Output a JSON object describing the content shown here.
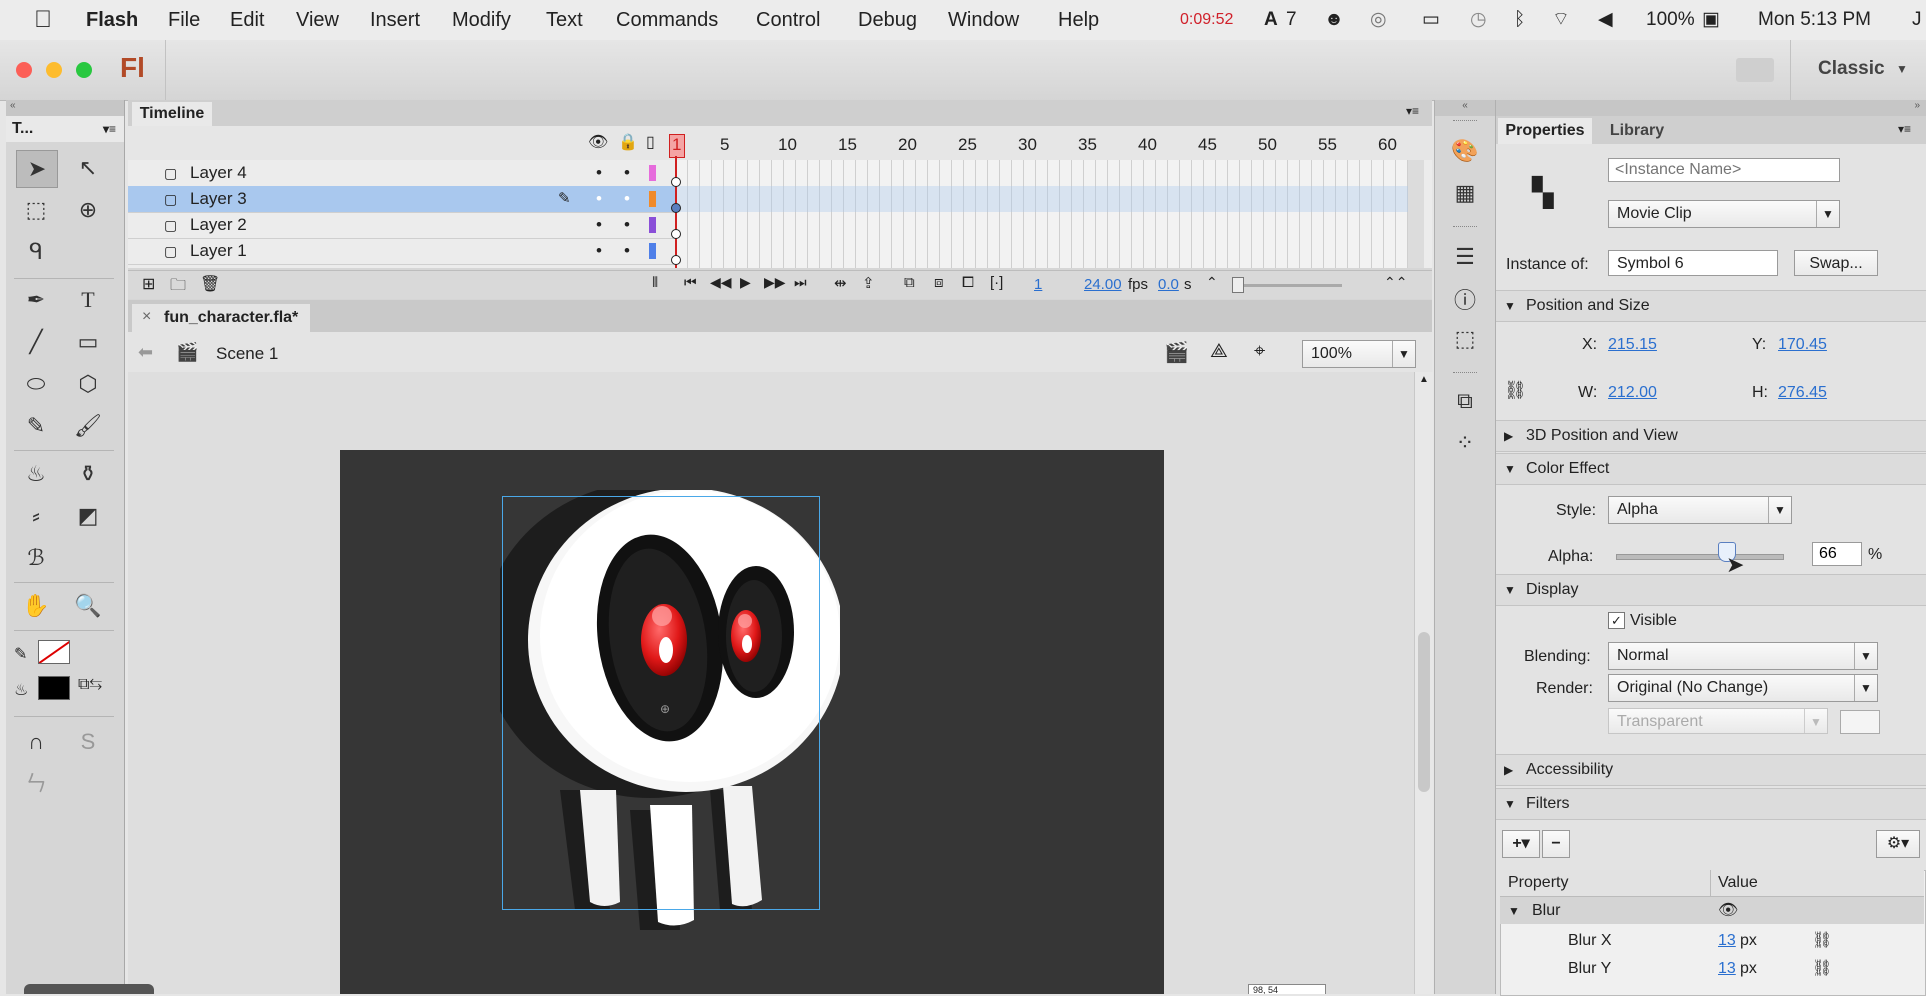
{
  "menubar": {
    "apple": "",
    "app": "Flash",
    "items": [
      "File",
      "Edit",
      "View",
      "Insert",
      "Modify",
      "Text",
      "Commands",
      "Control",
      "Debug",
      "Window",
      "Help"
    ],
    "rec_time": "0:09:52",
    "adobe_count": "7",
    "battery": "100%",
    "clock": "Mon 5:13 PM",
    "user": "J"
  },
  "appbar": {
    "logo": "Fl",
    "workspace": "Classic"
  },
  "tools": {
    "title": "T..."
  },
  "timeline": {
    "tab": "Timeline",
    "ticks": [
      "1",
      "5",
      "10",
      "15",
      "20",
      "25",
      "30",
      "35",
      "40",
      "45",
      "50",
      "55",
      "60"
    ],
    "layers": [
      {
        "name": "Layer 4",
        "color": "#e66cdc"
      },
      {
        "name": "Layer 3",
        "color": "#f08a2a"
      },
      {
        "name": "Layer 2",
        "color": "#8a4fd8"
      },
      {
        "name": "Layer 1",
        "color": "#4f7fe8"
      }
    ],
    "current_frame": "1",
    "fps": "24.00",
    "fps_unit": "fps",
    "time": "0.0",
    "time_unit": "s"
  },
  "document": {
    "tab": "fun_character.fla*",
    "close": "×",
    "scene": "Scene 1",
    "zoom": "100%",
    "coord_readout": "98, 54"
  },
  "properties": {
    "tab_props": "Properties",
    "tab_library": "Library",
    "instance_name_placeholder": "<Instance Name>",
    "symbol_type": "Movie Clip",
    "instance_of_label": "Instance of:",
    "instance_of": "Symbol 6",
    "swap": "Swap...",
    "pos_section": "Position and Size",
    "x_label": "X:",
    "x": "215.15",
    "y_label": "Y:",
    "y": "170.45",
    "w_label": "W:",
    "w": "212.00",
    "h_label": "H:",
    "h": "276.45",
    "section_3d": "3D Position and View",
    "color_section": "Color Effect",
    "style_label": "Style:",
    "style": "Alpha",
    "alpha_label": "Alpha:",
    "alpha": "66",
    "alpha_unit": "%",
    "display_section": "Display",
    "visible_label": "Visible",
    "blending_label": "Blending:",
    "blending": "Normal",
    "render_label": "Render:",
    "render": "Original (No Change)",
    "bg_option": "Transparent",
    "accessibility_section": "Accessibility",
    "filters_section": "Filters",
    "col_property": "Property",
    "col_value": "Value",
    "filter_name": "Blur",
    "blur_x_label": "Blur X",
    "blur_x": "13",
    "blur_y_label": "Blur Y",
    "blur_y": "13",
    "px": "px"
  }
}
